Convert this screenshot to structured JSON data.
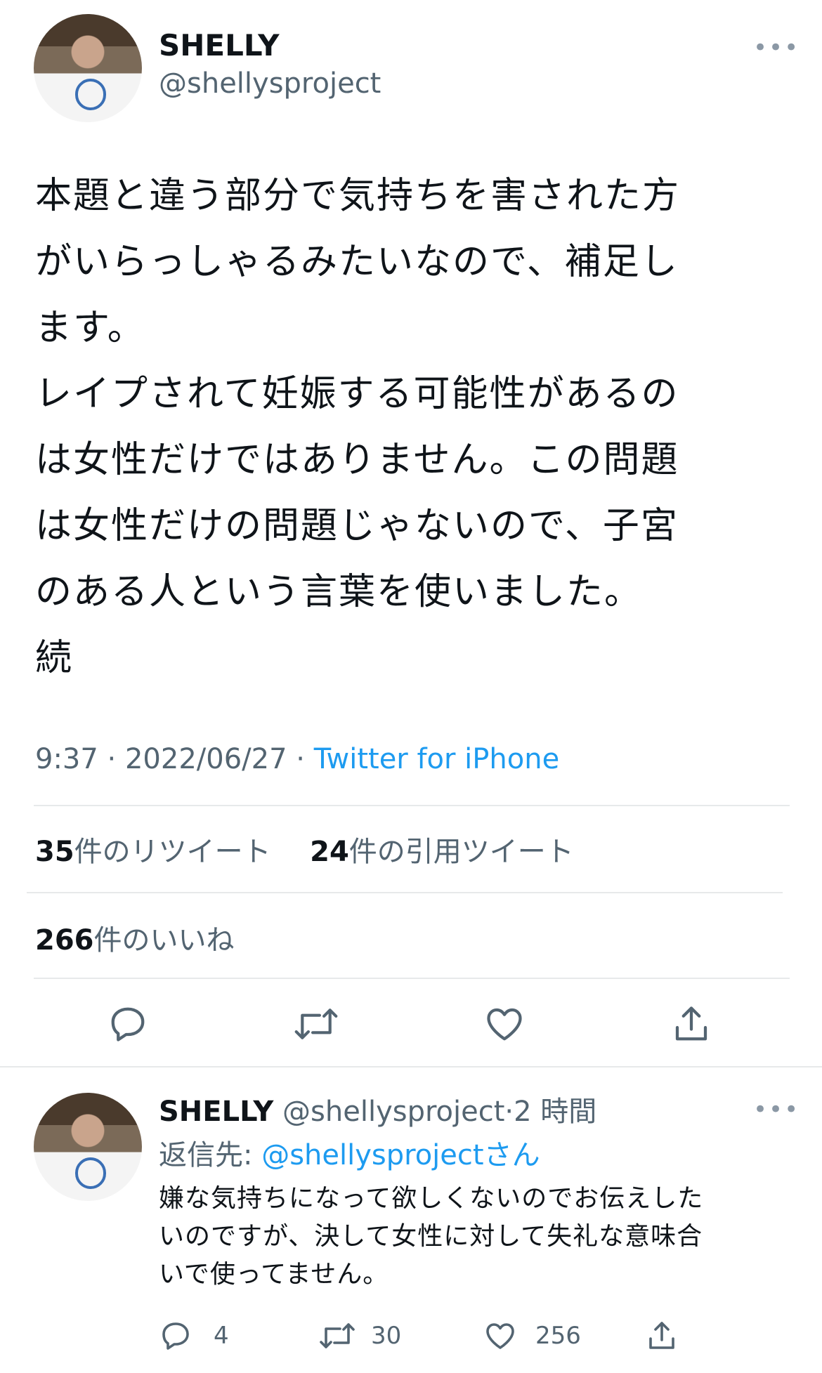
{
  "main_tweet": {
    "display_name": "SHELLY",
    "handle": "@shellysproject",
    "text_lines": [
      "本題と違う部分で気持ちを害された方",
      "がいらっしゃるみたいなので、補足し",
      "ます。",
      "レイプされて妊娠する可能性があるの",
      "は女性だけではありません。この問題",
      "は女性だけの問題じゃないので、子宮",
      "のある人という言葉を使いました。",
      "続"
    ],
    "time": "9:37",
    "date": "2022/06/27",
    "separator": "·",
    "source": "Twitter for iPhone",
    "retweets_count": "35",
    "retweets_label": "件のリツイート",
    "quotes_count": "24",
    "quotes_label": "件の引用ツイート",
    "likes_count": "266",
    "likes_label": "件のいいね"
  },
  "reply_tweet": {
    "display_name": "SHELLY",
    "handle": "@shellysproject",
    "separator": "·",
    "time_ago": "2 時間",
    "reply_prefix": "返信先:",
    "reply_to_handle": "@shellysproject",
    "reply_suffix": "さん",
    "text_lines": [
      "嫌な気持ちになって欲しくないのでお伝えした",
      "いのですが、決して女性に対して失礼な意味合",
      "いで使ってません。"
    ],
    "reply_count": "4",
    "retweet_count": "30",
    "like_count": "256"
  },
  "more_label": "•••",
  "colors": {
    "accent": "#1d9bf0",
    "muted": "#536471",
    "divider": "#e7e9ea"
  }
}
